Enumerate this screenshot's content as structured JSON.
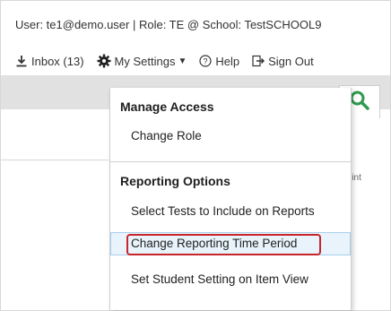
{
  "header": {
    "user_line": "User: te1@demo.user  |  Role: TE @ School: TestSCHOOL9"
  },
  "nav": {
    "inbox_label": "Inbox (13)",
    "settings_label": "My Settings",
    "help_label": "Help",
    "signout_label": "Sign Out"
  },
  "menu": {
    "manage_access_heading": "Manage Access",
    "change_role": "Change Role",
    "reporting_options_heading": "Reporting Options",
    "select_tests": "Select Tests to Include on Reports",
    "change_reporting_period": "Change Reporting Time Period",
    "set_student_setting": "Set Student Setting on Item View"
  },
  "background": {
    "print_label": "rint"
  },
  "colors": {
    "highlight_outline": "#c8252c",
    "search_icon": "#2e9a4e",
    "active_row": "#e8f3fb"
  },
  "icons": [
    "download-icon",
    "gear-icon",
    "help-icon",
    "sign-out-icon",
    "search-icon",
    "print-icon"
  ]
}
